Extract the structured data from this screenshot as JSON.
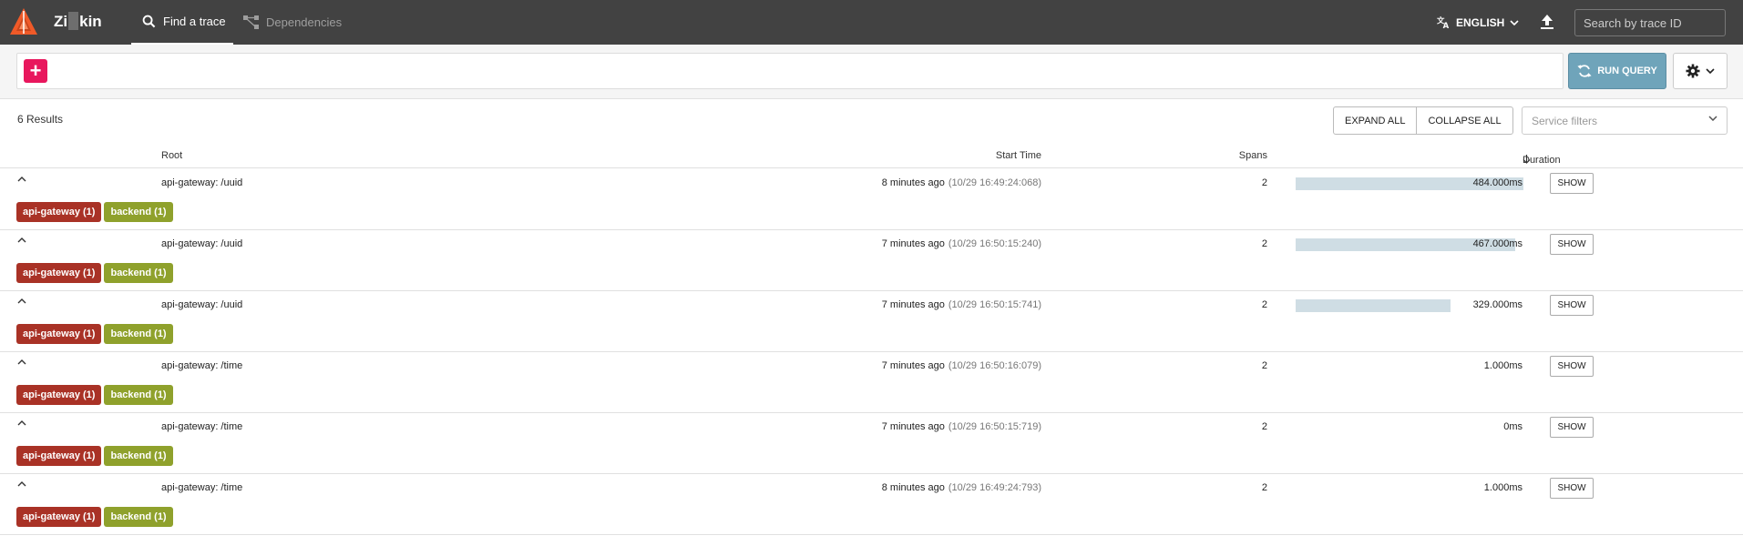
{
  "app": {
    "brand_text_left": "Zi",
    "brand_text_right": "kin",
    "logo_icon": "zipkin-logo-icon",
    "accent_color": "#f05a28"
  },
  "nav": {
    "tabs": [
      {
        "label": "Find a trace",
        "icon": "search-icon",
        "active": true
      },
      {
        "label": "Dependencies",
        "icon": "dependencies-icon",
        "active": false
      }
    ],
    "language": "ENGLISH",
    "trace_search_placeholder": "Search by trace ID"
  },
  "query": {
    "add_label": "+",
    "run_label": "RUN QUERY",
    "run_color": "#6fa4ba",
    "add_color": "#e8175d"
  },
  "results": {
    "count_label": "6 Results",
    "expand_all": "EXPAND ALL",
    "collapse_all": "COLLAPSE ALL",
    "service_filter_placeholder": "Service filters",
    "columns": {
      "root": "Root",
      "start": "Start Time",
      "spans": "Spans",
      "duration": "Duration"
    },
    "show_label": "SHOW",
    "badge_colors": {
      "api-gateway": "#a93226",
      "backend": "#8fa12c"
    },
    "rows": [
      {
        "root": "api-gateway: /uuid",
        "relative": "8 minutes ago",
        "absolute": "(10/29 16:49:24:068)",
        "spans": "2",
        "duration": "484.000ms",
        "bar_fraction": 1.0,
        "badges": [
          "api-gateway (1)",
          "backend (1)"
        ]
      },
      {
        "root": "api-gateway: /uuid",
        "relative": "7 minutes ago",
        "absolute": "(10/29 16:50:15:240)",
        "spans": "2",
        "duration": "467.000ms",
        "bar_fraction": 0.965,
        "badges": [
          "api-gateway (1)",
          "backend (1)"
        ]
      },
      {
        "root": "api-gateway: /uuid",
        "relative": "7 minutes ago",
        "absolute": "(10/29 16:50:15:741)",
        "spans": "2",
        "duration": "329.000ms",
        "bar_fraction": 0.68,
        "badges": [
          "api-gateway (1)",
          "backend (1)"
        ]
      },
      {
        "root": "api-gateway: /time",
        "relative": "7 minutes ago",
        "absolute": "(10/29 16:50:16:079)",
        "spans": "2",
        "duration": "1.000ms",
        "bar_fraction": 0.0,
        "badges": [
          "api-gateway (1)",
          "backend (1)"
        ]
      },
      {
        "root": "api-gateway: /time",
        "relative": "7 minutes ago",
        "absolute": "(10/29 16:50:15:719)",
        "spans": "2",
        "duration": "0ms",
        "bar_fraction": 0.0,
        "badges": [
          "api-gateway (1)",
          "backend (1)"
        ]
      },
      {
        "root": "api-gateway: /time",
        "relative": "8 minutes ago",
        "absolute": "(10/29 16:49:24:793)",
        "spans": "2",
        "duration": "1.000ms",
        "bar_fraction": 0.0,
        "badges": [
          "api-gateway (1)",
          "backend (1)"
        ]
      }
    ]
  }
}
